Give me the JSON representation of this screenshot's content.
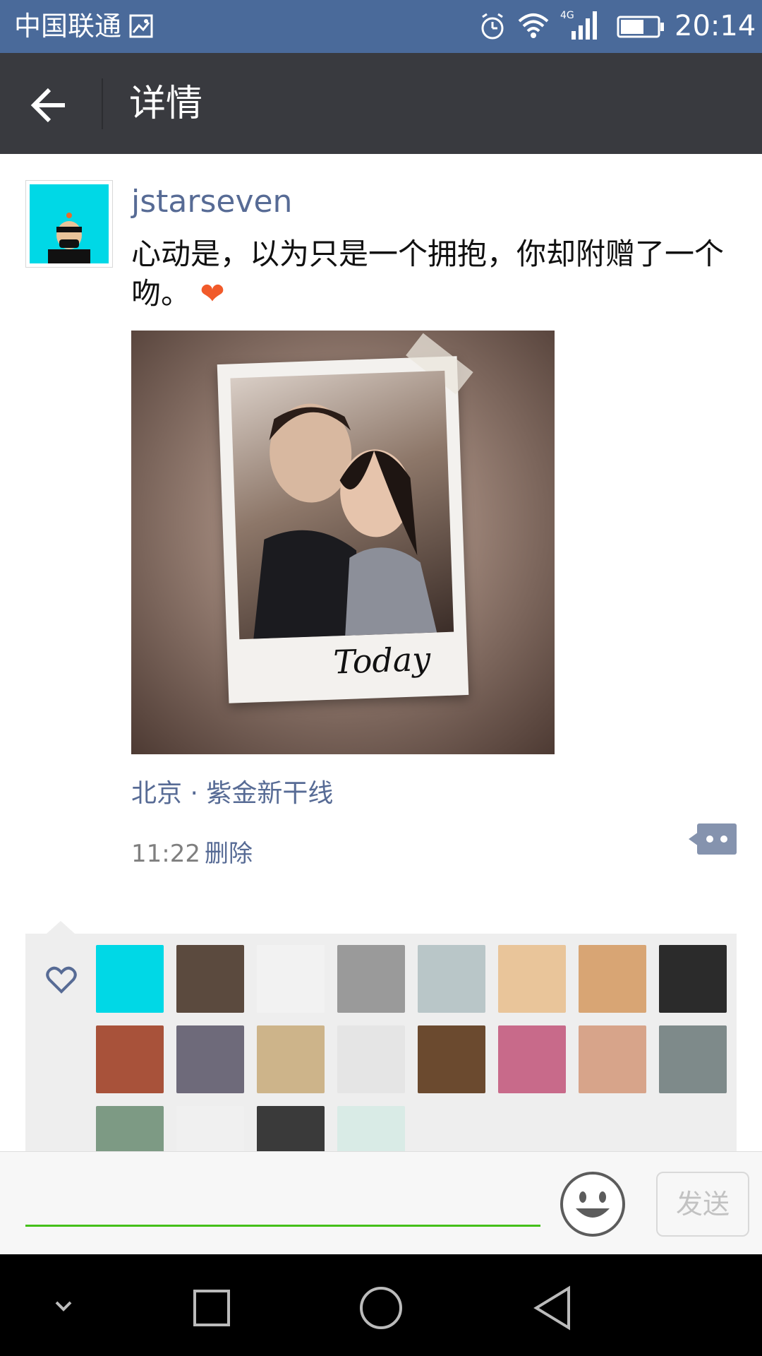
{
  "status_bar": {
    "carrier": "中国联通",
    "time": "20:14",
    "network": "4G",
    "icons": [
      "image-icon",
      "alarm-icon",
      "wifi-icon",
      "signal-icon",
      "battery-icon"
    ]
  },
  "app_bar": {
    "title": "详情",
    "back_icon": "back-arrow-icon"
  },
  "post": {
    "username": "jstarseven",
    "text": "心动是，以为只是一个拥抱，你却附赠了一个吻。",
    "emoji": "❤",
    "photo_caption": "Today",
    "location": "北京 · 紫金新干线",
    "time": "11:22",
    "delete_label": "删除",
    "more_icon": "comment-more-icon"
  },
  "likes": {
    "icon": "heart-outline-icon",
    "avatar_colors": [
      "#00d8e6",
      "#5b4a3e",
      "#f2f2f2",
      "#9a9a9a",
      "#b9c6c8",
      "#e9c59a",
      "#d8a574",
      "#2b2b2b",
      "#a8523a",
      "#6e6a7a",
      "#cdb48a",
      "#e5e5e5",
      "#6b4a2f",
      "#c86a8a",
      "#d7a48a",
      "#7e8a8a",
      "#7d9a84",
      "#f0f0f0",
      "#3a3a3a",
      "#d9ebe6"
    ]
  },
  "input_bar": {
    "send_label": "发送",
    "emoji_icon": "smiley-face-icon"
  },
  "nav_bar": {
    "icons": [
      "hide-keyboard-icon",
      "recents-square-icon",
      "home-circle-icon",
      "back-triangle-icon"
    ]
  },
  "colors": {
    "status_bar": "#4a6a9a",
    "app_bar": "#393a3f",
    "link_blue": "#576b95",
    "green_underline": "#45c01a"
  }
}
